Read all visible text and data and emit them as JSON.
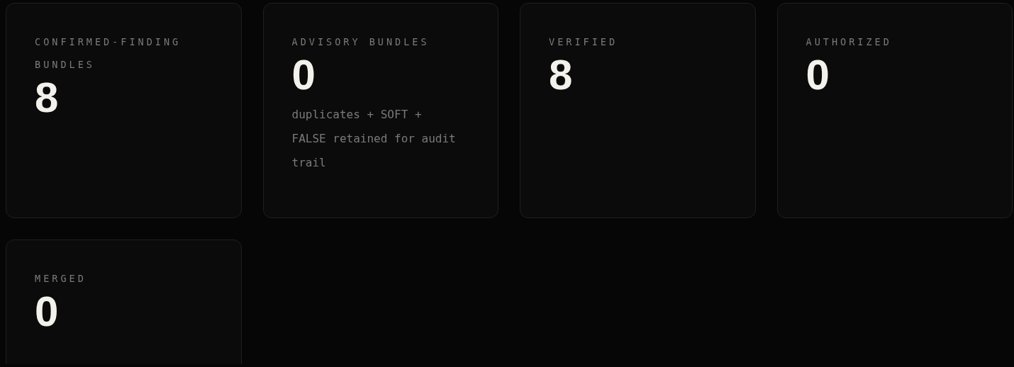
{
  "cards": [
    {
      "label": "CONFIRMED-FINDING BUNDLES",
      "value": "8"
    },
    {
      "label": "ADVISORY BUNDLES",
      "value": "0",
      "note": "duplicates + SOFT + FALSE retained for audit trail"
    },
    {
      "label": "VERIFIED",
      "value": "8"
    },
    {
      "label": "AUTHORIZED",
      "value": "0"
    },
    {
      "label": "MERGED",
      "value": "0"
    }
  ]
}
